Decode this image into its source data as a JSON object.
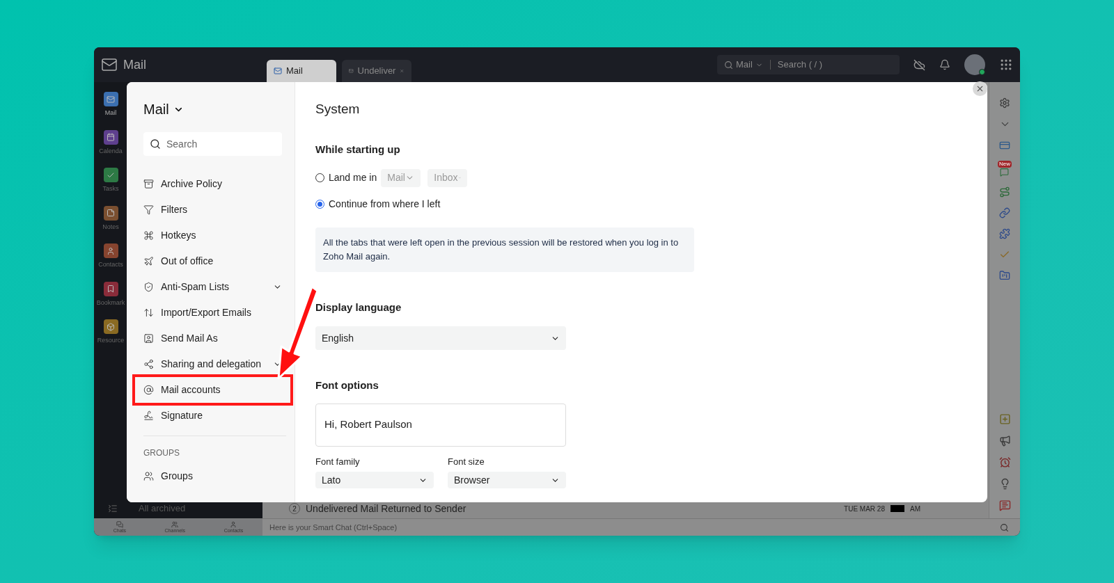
{
  "app": {
    "name": "Mail"
  },
  "tabs": [
    {
      "label": "Mail",
      "selected": true,
      "closable": false
    },
    {
      "label": "Undeliver",
      "selected": false,
      "closable": true
    }
  ],
  "search": {
    "scope": "Mail",
    "placeholder": "Search ( / )"
  },
  "app_rail": [
    {
      "label": "Mail",
      "selected": true,
      "color": "#3b6fb0"
    },
    {
      "label": "Calenda",
      "selected": false,
      "color": "#5e3f8e"
    },
    {
      "label": "Tasks",
      "selected": false,
      "color": "#2d7a45"
    },
    {
      "label": "Notes",
      "selected": false,
      "color": "#7a4f30"
    },
    {
      "label": "Contacts",
      "selected": false,
      "color": "#86442f"
    },
    {
      "label": "Bookmark",
      "selected": false,
      "color": "#8a2c3a"
    },
    {
      "label": "Resource",
      "selected": false,
      "color": "#8a6a22"
    }
  ],
  "folder_pane": {
    "footer": "All archived"
  },
  "mail_row": {
    "count": "2",
    "subject": "Undelivered Mail Returned to Sender",
    "date": "TUE MAR 28",
    "time": "AM"
  },
  "chat_bar": {
    "tabs": [
      "Chats",
      "Channels",
      "Contacts"
    ],
    "placeholder": "Here is your Smart Chat (Ctrl+Space)"
  },
  "settings": {
    "sidebar": {
      "title": "Mail",
      "search_placeholder": "Search",
      "items": [
        {
          "label": "Archive Policy",
          "expandable": false,
          "highlighted": false
        },
        {
          "label": "Filters",
          "expandable": false,
          "highlighted": false
        },
        {
          "label": "Hotkeys",
          "expandable": false,
          "highlighted": false
        },
        {
          "label": "Out of office",
          "expandable": false,
          "highlighted": false
        },
        {
          "label": "Anti-Spam Lists",
          "expandable": true,
          "highlighted": false
        },
        {
          "label": "Import/Export Emails",
          "expandable": false,
          "highlighted": false
        },
        {
          "label": "Send Mail As",
          "expandable": false,
          "highlighted": false
        },
        {
          "label": "Sharing and delegation",
          "expandable": true,
          "highlighted": false
        },
        {
          "label": "Mail accounts",
          "expandable": false,
          "highlighted": true
        },
        {
          "label": "Signature",
          "expandable": false,
          "highlighted": false
        }
      ],
      "group_heading": "GROUPS",
      "group_items": [
        {
          "label": "Groups",
          "expandable": false,
          "highlighted": false
        }
      ]
    },
    "title": "System",
    "startup": {
      "heading": "While starting up",
      "options": [
        {
          "label": "Land me in",
          "selected": false,
          "dropdowns": [
            {
              "value": "Mail",
              "disabled": true
            },
            {
              "value": "Inbox",
              "disabled": true
            }
          ]
        },
        {
          "label": "Continue from where I left",
          "selected": true
        }
      ],
      "info": "All the tabs that were left open in the previous session will be restored when you log in to Zoho Mail again."
    },
    "language": {
      "heading": "Display language",
      "value": "English"
    },
    "font": {
      "heading": "Font options",
      "preview": "Hi, Robert Paulson",
      "fields": [
        {
          "label": "Font family",
          "value": "Lato"
        },
        {
          "label": "Font size",
          "value": "Browser"
        }
      ]
    }
  },
  "right_rail": {
    "badge": "New"
  }
}
